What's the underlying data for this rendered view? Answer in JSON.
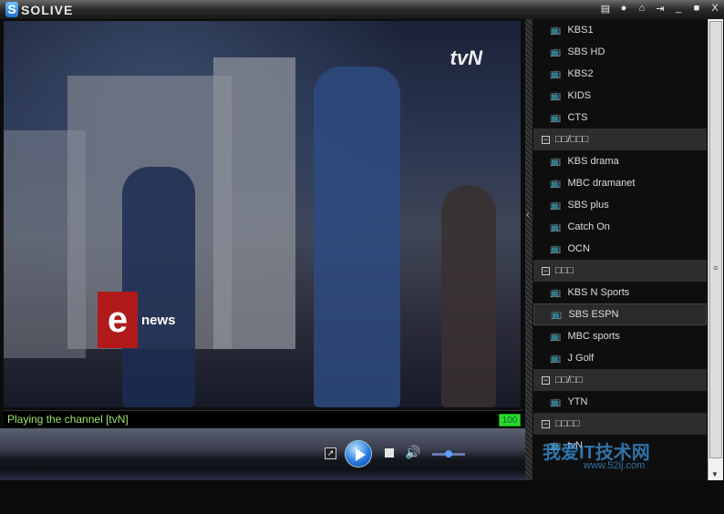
{
  "app": {
    "title": "SOLIVE",
    "logo_letter": "S"
  },
  "titlebar": {
    "icons": [
      "notes-icon",
      "chat-icon",
      "home-icon",
      "pin-icon",
      "minimize-icon",
      "maximize-icon",
      "close-icon"
    ],
    "glyphs": [
      "▤",
      "●",
      "⌂",
      "⇥",
      "_",
      "■",
      "X"
    ]
  },
  "video": {
    "channel_logo": "tvN",
    "news_logo_letter": "e",
    "news_logo_text": "news"
  },
  "status": {
    "text": "Playing the channel [tvN]",
    "volume": "100"
  },
  "controls": {
    "volume_level": 0.5
  },
  "channels": [
    {
      "type": "ch",
      "label": "KBS1"
    },
    {
      "type": "ch",
      "label": "SBS HD"
    },
    {
      "type": "ch",
      "label": "KBS2"
    },
    {
      "type": "ch",
      "label": "KIDS"
    },
    {
      "type": "ch",
      "label": "CTS"
    },
    {
      "type": "grp",
      "label": "□□/□□□"
    },
    {
      "type": "ch",
      "label": "KBS drama"
    },
    {
      "type": "ch",
      "label": "MBC dramanet"
    },
    {
      "type": "ch",
      "label": "SBS plus"
    },
    {
      "type": "ch",
      "label": "Catch On"
    },
    {
      "type": "ch",
      "label": "OCN"
    },
    {
      "type": "grp",
      "label": "□□□"
    },
    {
      "type": "ch",
      "label": "KBS N Sports"
    },
    {
      "type": "ch",
      "label": "SBS ESPN",
      "selected": true
    },
    {
      "type": "ch",
      "label": "MBC sports"
    },
    {
      "type": "ch",
      "label": "J Golf"
    },
    {
      "type": "grp",
      "label": "□□/□□"
    },
    {
      "type": "ch",
      "label": "YTN"
    },
    {
      "type": "grp",
      "label": "□□□□"
    },
    {
      "type": "ch",
      "label": "tvN"
    }
  ],
  "watermark": {
    "text": "我爱IT技术网",
    "url": "www.52ij.com"
  }
}
